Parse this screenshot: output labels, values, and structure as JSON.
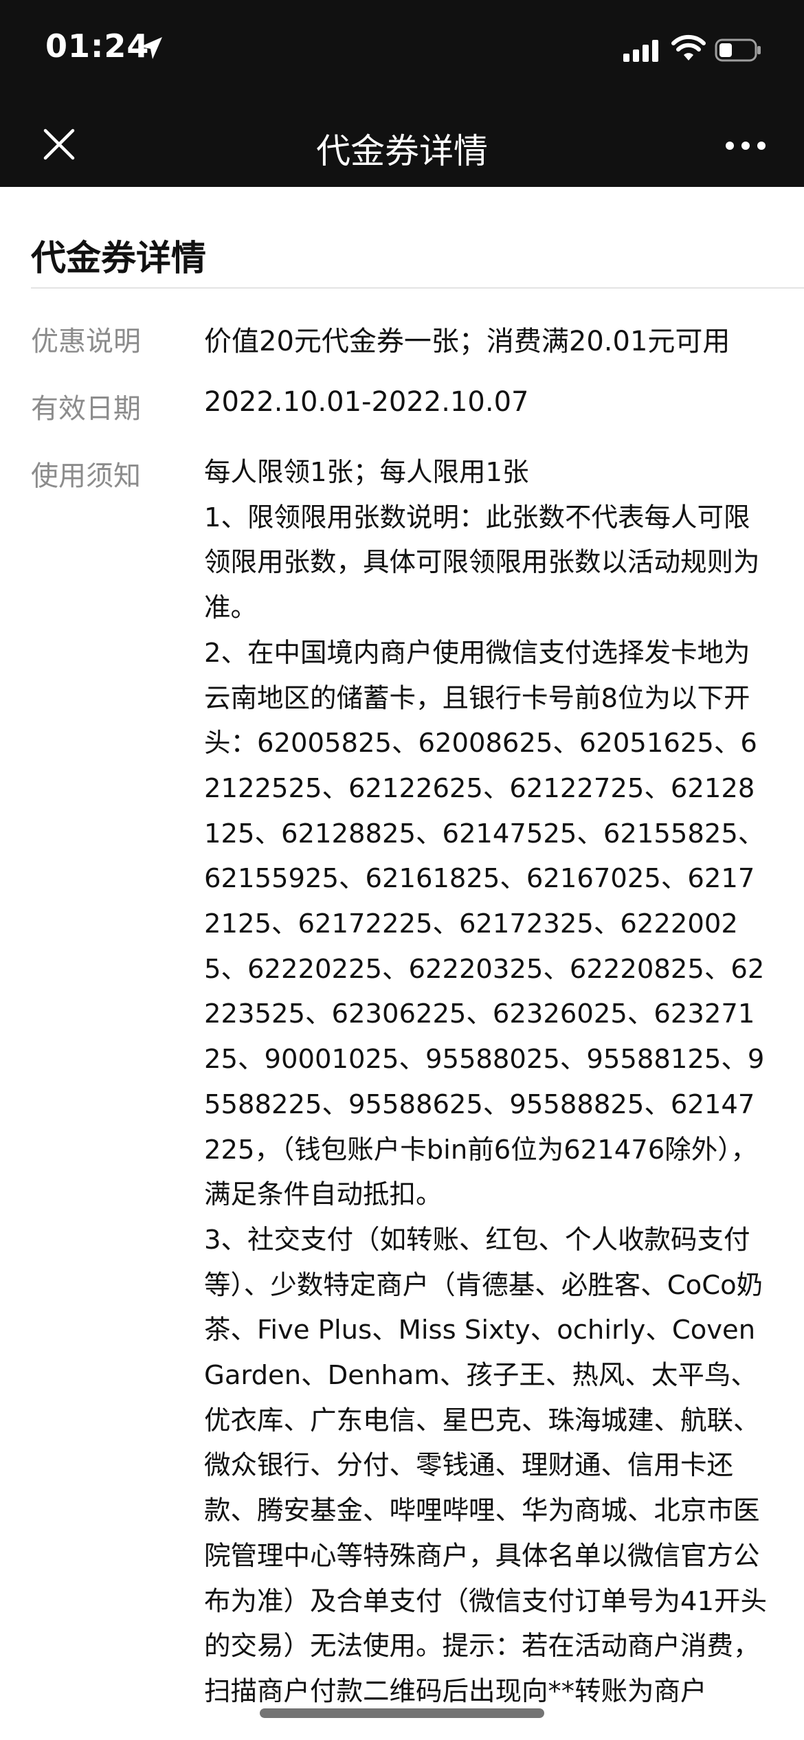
{
  "status_bar": {
    "time": "01:24",
    "icons": [
      "location-arrow-icon",
      "cellular-signal-icon",
      "wifi-icon",
      "battery-icon"
    ]
  },
  "nav": {
    "title": "代金券详情",
    "close_icon": "close-icon",
    "more_icon": "more-dots-icon"
  },
  "detail": {
    "section_title": "代金券详情",
    "offer_label": "优惠说明",
    "offer_value": "价值20元代金券一张；消费满20.01元可用",
    "validity_label": "有效日期",
    "validity_value": "2022.10.01-2022.10.07",
    "notes_label": "使用须知",
    "notes_lines": [
      "每人限领1张；每人限用1张",
      "1、限领限用张数说明：此张数不代表每人可限领限用张数，具体可限领限用张数以活动规则为准。",
      "2、在中国境内商户使用微信支付选择发卡地为云南地区的储蓄卡，且银行卡号前8位为以下开头：62005825、62008625、62051625、62122525、62122625、62122725、62128125、62128825、62147525、62155825、62155925、62161825、62167025、62172125、62172225、62172325、62220025、62220225、62220325、62220825、62223525、62306225、62326025、62327125、90001025、95588025、95588125、95588225、95588625、95588825、62147225，（钱包账户卡bin前6位为621476除外），满足条件自动抵扣。",
      "3、社交支付（如转账、红包、个人收款码支付等）、少数特定商户（肯德基、必胜客、CoCo奶茶、Five Plus、Miss Sixty、ochirly、CovenGarden、Denham、孩子王、热风、太平鸟、优衣库、广东电信、星巴克、珠海城建、航联、微众银行、分付、零钱通、理财通、信用卡还款、腾安基金、哔哩哔哩、华为商城、北京市医院管理中心等特殊商户，具体名单以微信官方公布为准）及合单支付（微信支付订单号为41开头的交易）无法使用。提示：若在活动商户消费，扫描商户付款二维码后出现向**转账为商户"
    ]
  }
}
